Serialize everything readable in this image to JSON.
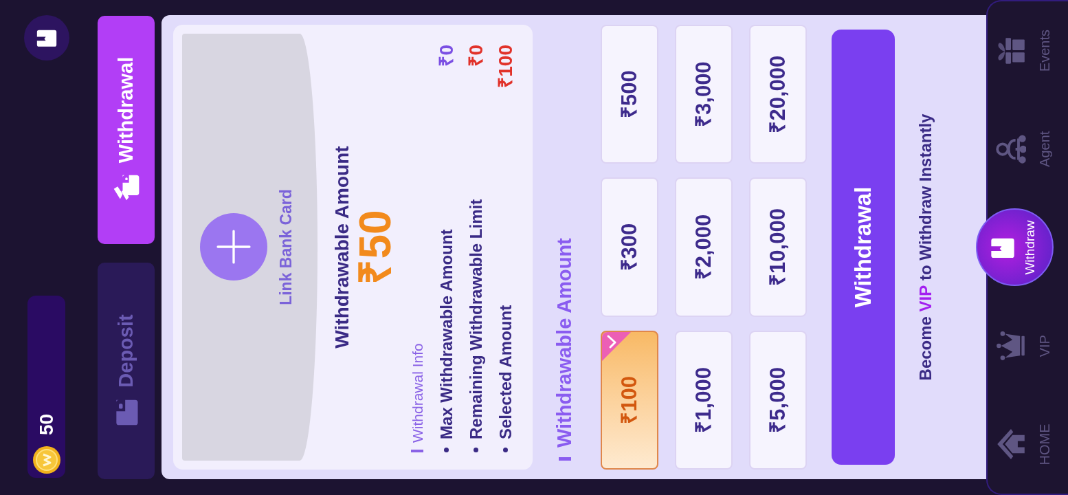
{
  "header": {
    "balance": "50"
  },
  "tabs": [
    {
      "label": "Deposit",
      "selected": false
    },
    {
      "label": "Withdrawal",
      "selected": true
    }
  ],
  "bank_card": {
    "label": "Link Bank Card"
  },
  "withdrawable": {
    "title": "Withdrawable Amount",
    "amount": "₹50"
  },
  "withdrawal_info": {
    "title": "Withdrawal Info",
    "items": [
      {
        "label": "Max Withdrawable Amount",
        "value": "₹0",
        "color": "#7b4fe3"
      },
      {
        "label": "Remaining Withdrawable Limit",
        "value": "₹0",
        "color": "#e1322a"
      },
      {
        "label": "Selected Amount",
        "value": "₹100",
        "color": "#e1322a"
      }
    ]
  },
  "amount_options": {
    "title": "Withdrawable Amount",
    "options": [
      {
        "label": "₹100",
        "selected": true
      },
      {
        "label": "₹300",
        "selected": false
      },
      {
        "label": "₹500",
        "selected": false
      },
      {
        "label": "₹1,000",
        "selected": false
      },
      {
        "label": "₹2,000",
        "selected": false
      },
      {
        "label": "₹3,000",
        "selected": false
      },
      {
        "label": "₹5,000",
        "selected": false
      },
      {
        "label": "₹10,000",
        "selected": false
      },
      {
        "label": "₹20,000",
        "selected": false
      }
    ]
  },
  "withdraw_button": "Withdrawal",
  "vip_note": "Become **VIP** to Withdraw Instantly",
  "nav": [
    {
      "label": "HOME",
      "selected": false
    },
    {
      "label": "VIP",
      "selected": false
    },
    {
      "label": "Withdraw",
      "selected": true
    },
    {
      "label": "Agent",
      "selected": false
    },
    {
      "label": "Events",
      "selected": false
    }
  ]
}
